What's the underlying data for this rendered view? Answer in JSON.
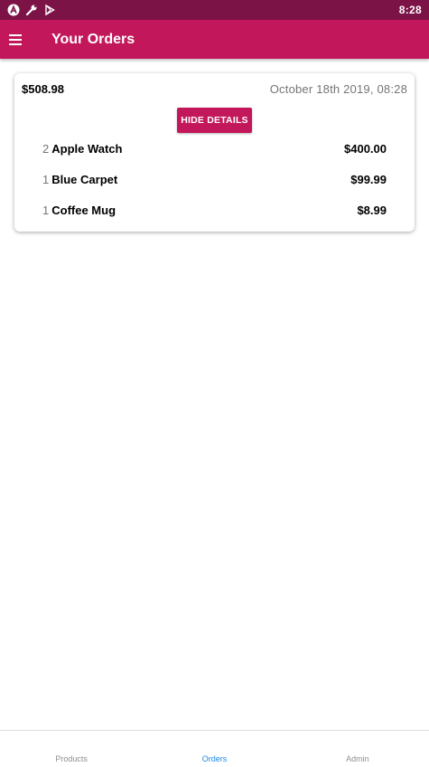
{
  "status_bar": {
    "time": "8:28",
    "icons": [
      "a-circle-icon",
      "wrench-icon",
      "play-store-icon"
    ]
  },
  "app_bar": {
    "title": "Your Orders",
    "menu_icon": "hamburger-menu-icon"
  },
  "order": {
    "total": "$508.98",
    "date": "October 18th 2019, 08:28",
    "toggle_label": "HIDE DETAILS",
    "items": [
      {
        "quantity": "2",
        "name": "Apple Watch",
        "price": "$400.00"
      },
      {
        "quantity": "1",
        "name": "Blue Carpet",
        "price": "$99.99"
      },
      {
        "quantity": "1",
        "name": "Coffee Mug",
        "price": "$8.99"
      }
    ]
  },
  "bottom_nav": {
    "tabs": [
      {
        "label": "Products",
        "active": false
      },
      {
        "label": "Orders",
        "active": true
      },
      {
        "label": "Admin",
        "active": false
      }
    ]
  },
  "colors": {
    "status_bar": "#7c1347",
    "primary": "#c2185b",
    "active_tab": "#1e88e5",
    "muted_text": "#757575"
  }
}
